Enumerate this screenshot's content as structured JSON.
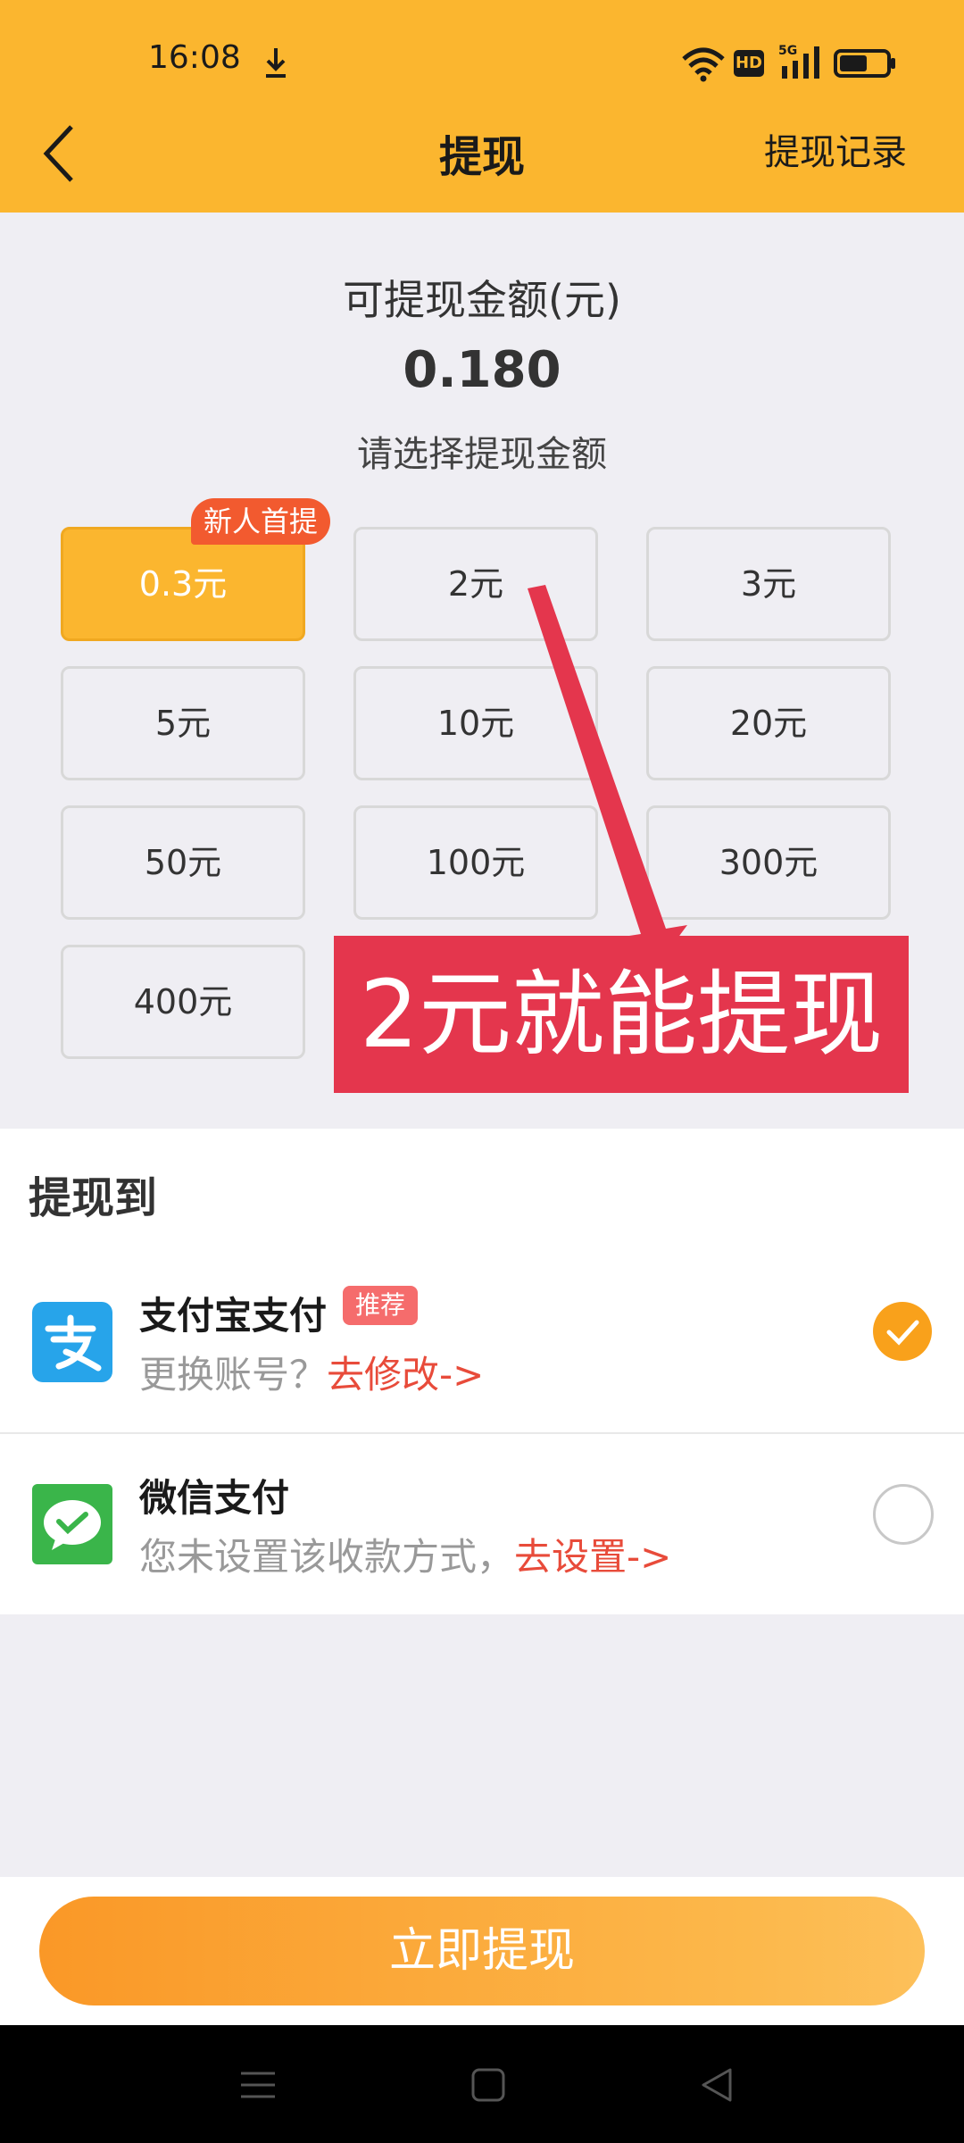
{
  "status_bar": {
    "time": "16:08",
    "network_badge": "HD",
    "network_type": "5G",
    "battery_level": 0.6
  },
  "header": {
    "title": "提现",
    "right_link": "提现记录"
  },
  "balance": {
    "label": "可提现金额(元)",
    "value": "0.180",
    "select_prompt": "请选择提现金额"
  },
  "amount_options": [
    {
      "label": "0.3元",
      "selected": true,
      "badge": "新人首提"
    },
    {
      "label": "2元"
    },
    {
      "label": "3元"
    },
    {
      "label": "5元"
    },
    {
      "label": "10元"
    },
    {
      "label": "20元"
    },
    {
      "label": "50元"
    },
    {
      "label": "100元"
    },
    {
      "label": "300元"
    },
    {
      "label": "400元"
    }
  ],
  "promo": {
    "text": "2元就能提现",
    "color": "#e4364d"
  },
  "payment": {
    "section_title": "提现到",
    "methods": [
      {
        "name": "支付宝支付",
        "badge": "推荐",
        "sub": "更换账号？",
        "action": "去修改->",
        "selected": true,
        "icon": "alipay-icon"
      },
      {
        "name": "微信支付",
        "sub": "您未设置该收款方式，",
        "action": "去设置->",
        "selected": false,
        "icon": "wechat-icon"
      }
    ]
  },
  "submit": {
    "label": "立即提现"
  },
  "colors": {
    "header": "#fbb62f",
    "accent": "#f9a11b",
    "action_red": "#e84b3a"
  }
}
